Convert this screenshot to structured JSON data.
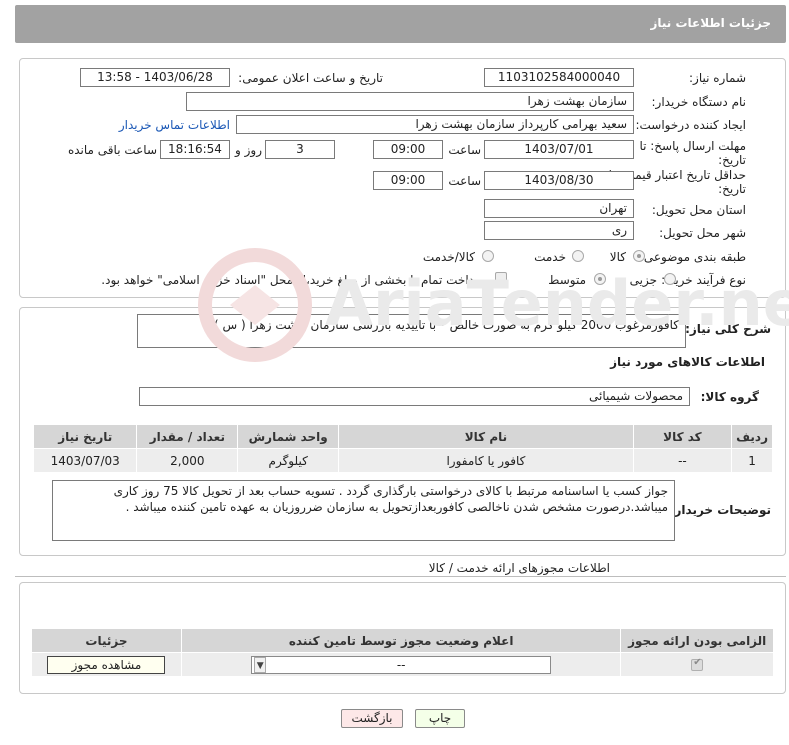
{
  "header": {
    "title": "جزئیات اطلاعات نیاز"
  },
  "form": {
    "need_number_label": "شماره نیاز:",
    "need_number": "1103102584000040",
    "announce_label": "تاریخ و ساعت اعلان عمومی:",
    "announce_value": "1403/06/28 - 13:58",
    "buyer_label": "نام دستگاه خریدار:",
    "buyer_value": "سازمان بهشت زهرا",
    "creator_label": "ایجاد کننده درخواست:",
    "creator_value": "سعید بهرامی کارپرداز سازمان بهشت زهرا",
    "contact_link": "اطلاعات تماس خریدار",
    "deadline_label_1": "مهلت ارسال پاسخ: تا",
    "deadline_label_2": "تاریخ:",
    "deadline_date": "1403/07/01",
    "time_label": "ساعت",
    "deadline_time": "09:00",
    "days_value": "3",
    "days_label": "روز و",
    "remaining_time": "18:16:54",
    "remaining_label": "ساعت باقی مانده",
    "validity_label_1": "حداقل تاریخ اعتبار قیمت: تا",
    "validity_label_2": "تاریخ:",
    "validity_date": "1403/08/30",
    "validity_time": "09:00",
    "province_label": "استان محل تحویل:",
    "province_value": "تهران",
    "city_label": "شهر محل تحویل:",
    "city_value": "ری",
    "category_label": "طبقه بندی موضوعی:",
    "category_options": [
      "کالا",
      "خدمت",
      "کالا/خدمت"
    ],
    "process_label": "نوع فرآیند خرید :",
    "process_options": [
      "جزیی",
      "متوسط"
    ],
    "payment_note": "پرداخت تمام یا بخشی از مبلغ خرید،از محل \"اسناد خزانه اسلامی\" خواهد بود."
  },
  "description": {
    "label": "شرح کلی نیاز:",
    "text": "کافورمرغوب 2000 کیلو گرم به صورت خالص * با تاییدیه بازرسی سازمان بهشت زهرا ( س )"
  },
  "goods": {
    "title": "اطلاعات کالاهای مورد نیاز",
    "group_label": "گروه کالا:",
    "group_value": "محصولات شیمیائی",
    "columns": [
      "ردیف",
      "کد کالا",
      "نام کالا",
      "واحد شمارش",
      "تعداد / مقدار",
      "تاریخ نیاز"
    ],
    "rows": [
      {
        "row": "1",
        "code": "--",
        "name": "کافور یا کامفورا",
        "unit": "کیلوگرم",
        "qty": "2,000",
        "date": "1403/07/03"
      }
    ]
  },
  "buyer_notes": {
    "label": "توضیحات خریدار:",
    "text": "جواز کسب یا اساسنامه مرتبط با کالای درخواستی بارگذاری گردد . تسویه حساب بعد از تحویل کالا 75 روز کاری میباشد.درصورت مشخص شدن ناخالصی کافوربعدازتحویل به سازمان ضرروزیان به عهده تامین کننده میباشد ."
  },
  "permits": {
    "title": "اطلاعات مجوزهای ارائه خدمت / کالا",
    "columns": [
      "الزامی بودن ارائه مجوز",
      "اعلام وضعیت مجوز توسط تامین کننده",
      "جزئیات"
    ],
    "select_value": "--",
    "view_button": "مشاهده مجوز"
  },
  "footer": {
    "print_button": "چاپ",
    "back_button": "بازگشت"
  },
  "watermark": {
    "text": "AriaTender.neT"
  }
}
